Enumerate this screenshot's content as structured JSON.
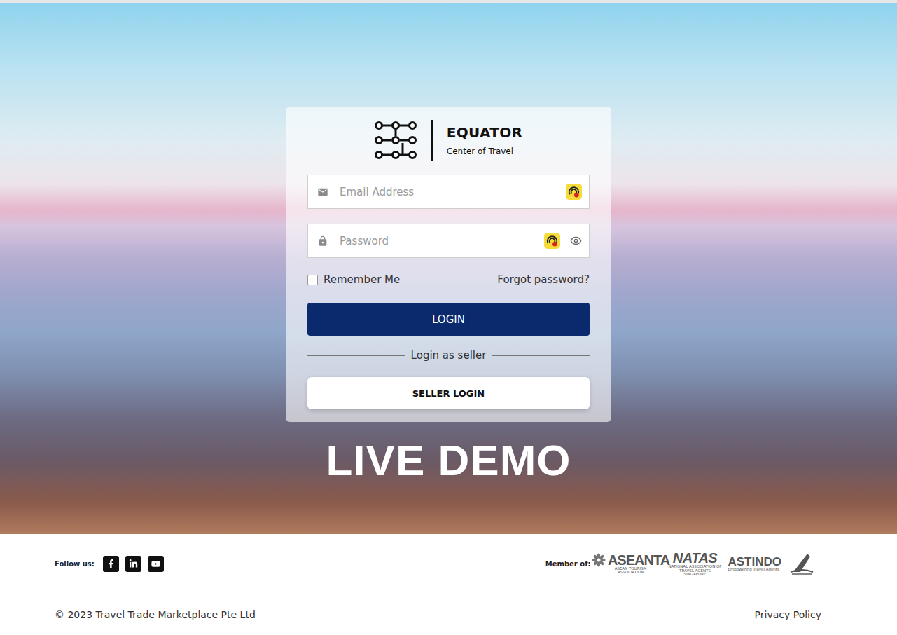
{
  "brand": {
    "name": "EQUATOR",
    "tagline": "Center of Travel"
  },
  "fields": [
    {
      "kind": "email",
      "placeholder": "Email Address"
    },
    {
      "kind": "password",
      "placeholder": "Password"
    }
  ],
  "remember_me": {
    "label": "Remember Me",
    "checked": false
  },
  "forgot_password": "Forgot password?",
  "login_button": "LOGIN",
  "seller_divider": "Login as seller",
  "seller_button": "SELLER LOGIN",
  "banner": "LIVE DEMO",
  "footer": {
    "follow_label": "Follow us:",
    "social": [
      {
        "kind": "facebook"
      },
      {
        "kind": "linkedin"
      },
      {
        "kind": "youtube"
      }
    ],
    "member_label": "Member of:",
    "members": [
      {
        "kind": "aseanta",
        "name": "ASEANTA",
        "subtitle": "ASEAN TOURISM ASSOCIATION"
      },
      {
        "kind": "natas",
        "name": "NATAS",
        "subtitle": "NATIONAL ASSOCIATION OF TRAVEL AGENTS SINGAPORE"
      },
      {
        "kind": "astindo",
        "name": "ASTINDO",
        "subtitle": "Empowering Travel Agents"
      }
    ],
    "copyright": "© 2023 Travel Trade Marketplace Pte Ltd",
    "privacy": "Privacy Policy"
  }
}
